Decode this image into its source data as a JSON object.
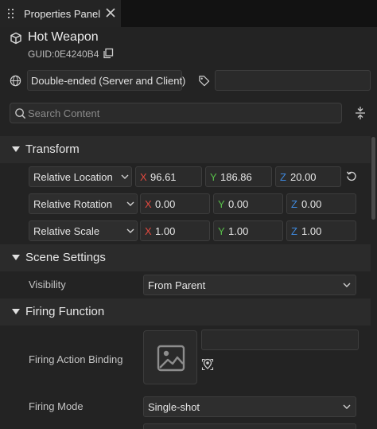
{
  "tab": {
    "title": "Properties Panel"
  },
  "asset": {
    "name": "Hot Weapon",
    "guid": "GUID:0E4240B4"
  },
  "network": {
    "mode": "Double-ended (Server and Client)"
  },
  "tags": {
    "value": ""
  },
  "search": {
    "placeholder": "Search Content",
    "value": ""
  },
  "sections": {
    "transform": {
      "label": "Transform",
      "rows": [
        {
          "label": "Relative Location",
          "x": "96.61",
          "y": "186.86",
          "z": "20.00"
        },
        {
          "label": "Relative Rotation",
          "x": "0.00",
          "y": "0.00",
          "z": "0.00"
        },
        {
          "label": "Relative Scale",
          "x": "1.00",
          "y": "1.00",
          "z": "1.00"
        }
      ]
    },
    "scene": {
      "label": "Scene Settings",
      "visibility_label": "Visibility",
      "visibility_value": "From Parent"
    },
    "firing": {
      "label": "Firing Function",
      "binding_label": "Firing Action Binding",
      "binding_value": "",
      "mode_label": "Firing Mode",
      "mode_value": "Single-shot"
    }
  },
  "axes": {
    "x": "X",
    "y": "Y",
    "z": "Z"
  },
  "colors": {
    "axis_x": "#e0493f",
    "axis_y": "#58c04a",
    "axis_z": "#3f8ae0"
  }
}
